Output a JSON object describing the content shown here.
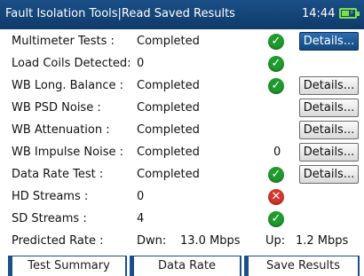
{
  "header": {
    "title": "Fault Isolation Tools|Read Saved Results",
    "time": "14:44",
    "battery_icon": "battery-charging-icon",
    "battery_color": "#7ee04b"
  },
  "results": [
    {
      "label": "Multimeter Tests :",
      "value": "Completed",
      "status": "pass",
      "button": "Details...",
      "button_active": true
    },
    {
      "label": "Load Coils Detected:",
      "value": "0",
      "status": "pass",
      "button": ""
    },
    {
      "label": "WB Long. Balance :",
      "value": "Completed",
      "status": "pass",
      "button": "Details..."
    },
    {
      "label": "WB  PSD Noise :",
      "value": "Completed",
      "status": "",
      "button": "Details..."
    },
    {
      "label": "WB  Attenuation :",
      "value": "Completed",
      "status": "",
      "button": "Details..."
    },
    {
      "label": "WB Impulse Noise :",
      "value": "Completed",
      "count": "0",
      "button": "Details..."
    },
    {
      "label": "Data Rate Test :",
      "value": "Completed",
      "status": "pass",
      "button": "Details..."
    },
    {
      "label": "HD Streams :",
      "value": "0",
      "status": "fail",
      "button": ""
    },
    {
      "label": "SD Streams :",
      "value": "4",
      "status": "pass",
      "button": ""
    }
  ],
  "predicted": {
    "label": "Predicted Rate :",
    "down_label": "Dwn:",
    "down_value": "13.0 Mbps",
    "up_label": "Up:",
    "up_value": "1.2 Mbps"
  },
  "tabs": [
    "Test Summary",
    "Data Rate",
    "Save Results"
  ],
  "colors": {
    "pass": "#1f9a2e",
    "fail": "#d5372d",
    "accent": "#1b4f87"
  }
}
